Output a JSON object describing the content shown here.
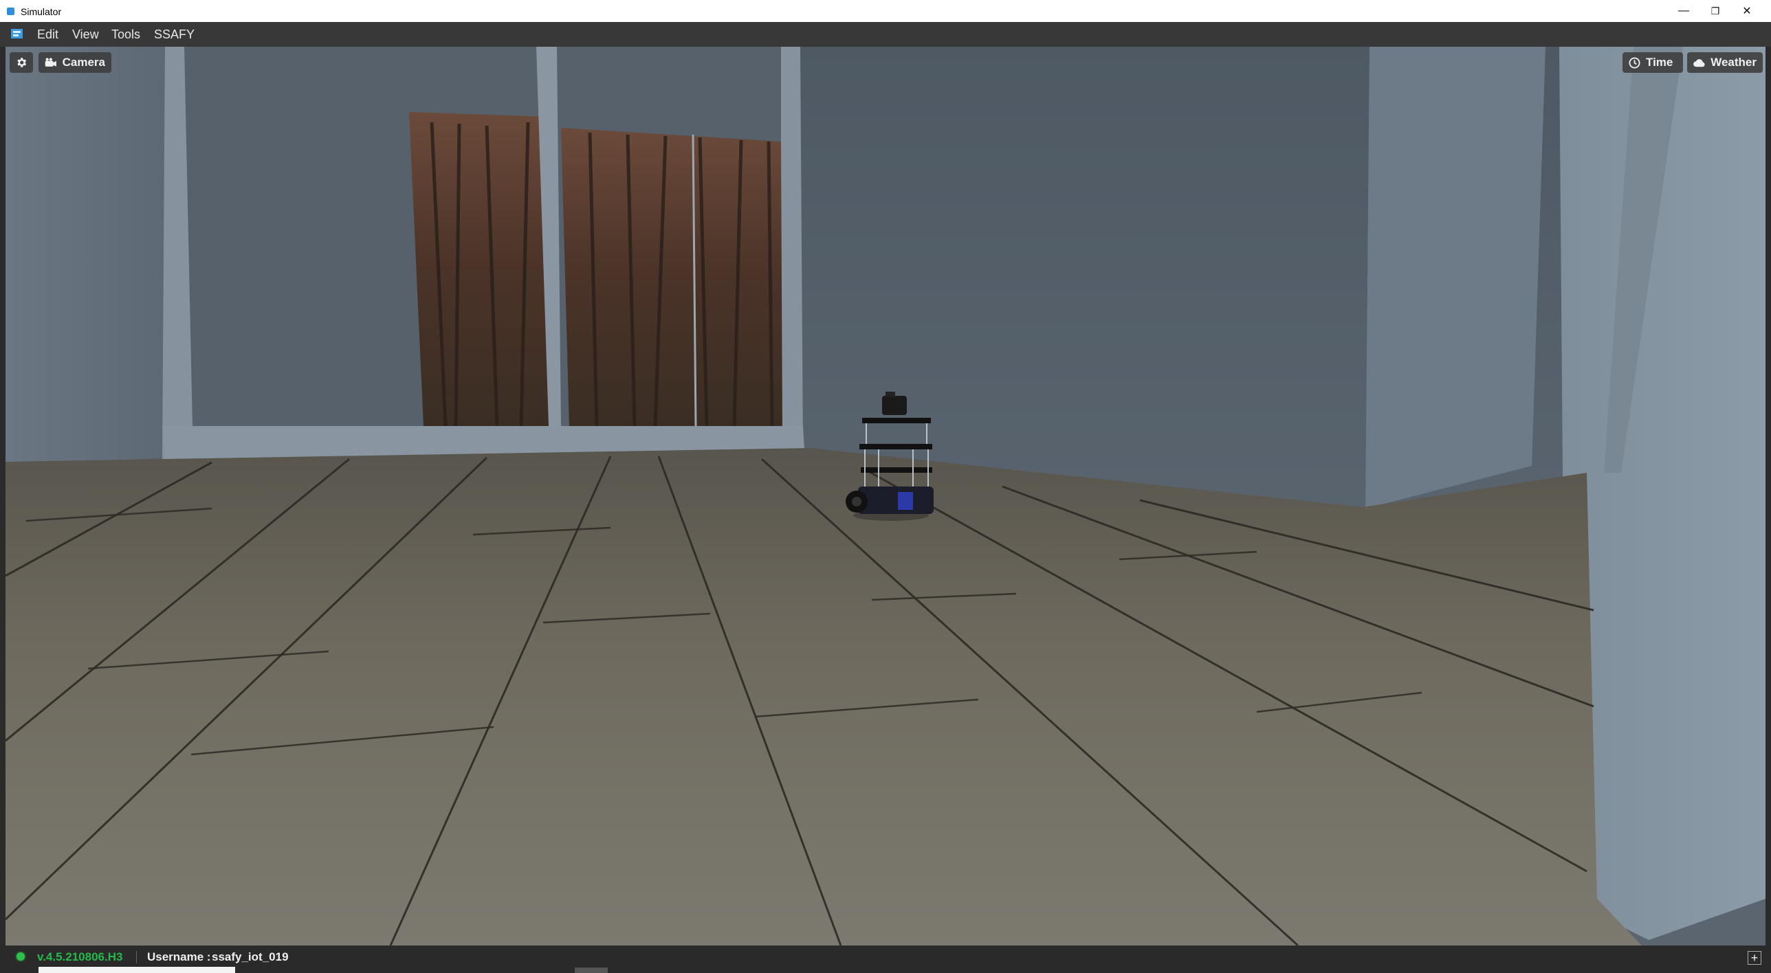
{
  "window": {
    "title": "Simulator",
    "minimize_glyph": "—",
    "restore_glyph": "❐",
    "close_glyph": "✕"
  },
  "menu": {
    "items": [
      "Edit",
      "View",
      "Tools",
      "SSAFY"
    ]
  },
  "viewport": {
    "settings_icon": "gear-icon",
    "camera_label": "Camera",
    "time_label": "Time",
    "weather_label": "Weather"
  },
  "status": {
    "version": "v.4.5.210806.H3",
    "username_label": "Username :",
    "username": "ssafy_iot_019",
    "connection_color": "#2fc04a",
    "version_color": "#27b84a"
  },
  "colors": {
    "titlebar": "#ffffff",
    "menubar": "#383838",
    "statusbar": "#2a2a2a",
    "wall": "#5a6570",
    "floor": "#6e6a5e"
  }
}
